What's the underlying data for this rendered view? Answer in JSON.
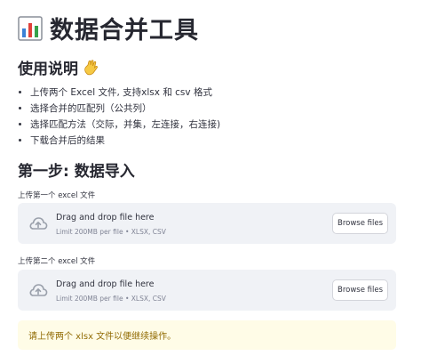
{
  "header": {
    "title": "数据合并工具",
    "title_icon": "bar-chart-icon"
  },
  "usage": {
    "heading": "使用说明",
    "heading_icon": "waving-hand-icon",
    "items": [
      "上传两个 Excel 文件, 支持xlsx 和 csv 格式",
      "选择合并的匹配列（公共列）",
      "选择匹配方法（交际，并集，左连接，右连接)",
      "下载合并后的结果"
    ]
  },
  "step1": {
    "heading": "第一步: 数据导入"
  },
  "uploaders": [
    {
      "label": "上传第一个 excel 文件",
      "drop_text": "Drag and drop file here",
      "limit_text": "Limit 200MB per file • XLSX, CSV",
      "button_label": "Browse files",
      "icon": "cloud-upload-icon"
    },
    {
      "label": "上传第二个 excel 文件",
      "drop_text": "Drag and drop file here",
      "limit_text": "Limit 200MB per file • XLSX, CSV",
      "button_label": "Browse files",
      "icon": "cloud-upload-icon"
    }
  ],
  "warning": {
    "text": "请上传两个 xlsx 文件以便继续操作。"
  },
  "colors": {
    "dropzone_bg": "#f0f2f6",
    "warning_bg": "#fffce7",
    "warning_text": "#926c05"
  }
}
